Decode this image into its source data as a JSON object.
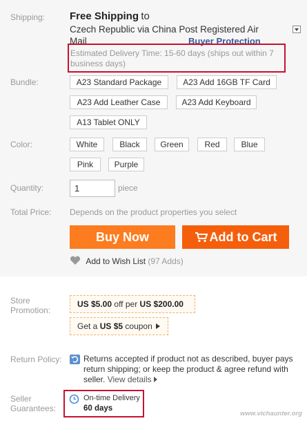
{
  "shipping": {
    "label": "Shipping:",
    "title": "Free Shipping",
    "to": "to",
    "line1": "Czech Republic via China Post Registered Air",
    "line2": "Mail",
    "buyer_protection": "Buyer Protection",
    "estimate_line1": "Estimated Delivery Time: 15-60 days (ships out within 7",
    "estimate_line2": "business days)"
  },
  "bundle": {
    "label": "Bundle:",
    "options": [
      "A23 Standard Package",
      "A23 Add 16GB TF Card",
      "A23 Add Leather Case",
      "A23 Add Keyboard",
      "A13 Tablet ONLY"
    ]
  },
  "color": {
    "label": "Color:",
    "options": [
      "White",
      "Black",
      "Green",
      "Red",
      "Blue",
      "Pink",
      "Purple"
    ]
  },
  "quantity": {
    "label": "Quantity:",
    "value": "1",
    "unit": "piece"
  },
  "total": {
    "label": "Total Price:",
    "text": "Depends on the product properties you select"
  },
  "buttons": {
    "buy_now": "Buy Now",
    "add_to_cart": "Add to Cart"
  },
  "wishlist": {
    "label": "Add to Wish List",
    "count": "(97 Adds)"
  },
  "store_promotion": {
    "label_line1": "Store",
    "label_line2": "Promotion:",
    "offer_amount": "US $5.00",
    "offer_mid": "off per",
    "offer_threshold": "US $200.00",
    "coupon_prefix": "Get a",
    "coupon_amount": "US $5",
    "coupon_suffix": "coupon"
  },
  "return_policy": {
    "label": "Return Policy:",
    "line1": "Returns accepted if product not as described, buyer pays",
    "line2": "return shipping; or keep the product & agree refund with",
    "line3_prefix": "seller.",
    "view_details": "View details"
  },
  "seller_guarantees": {
    "label_line1": "Seller",
    "label_line2": "Guarantees:",
    "title": "On-time Delivery",
    "days": "60 days"
  },
  "watermark": "www.vichaunter.org",
  "colors": {
    "buy_now": "#fc7c1f",
    "add_to_cart": "#f55f0c",
    "highlight_box": "#c8102e",
    "link": "#3b5998"
  }
}
